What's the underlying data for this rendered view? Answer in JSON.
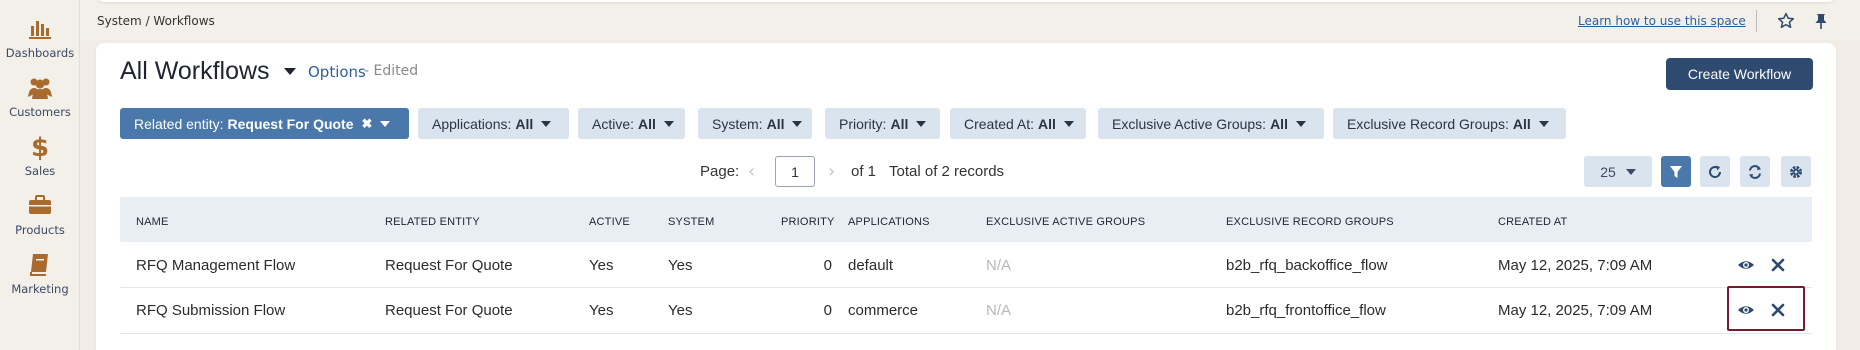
{
  "sidebar": {
    "items": [
      {
        "label": "Dashboards",
        "icon": "bar-chart-icon"
      },
      {
        "label": "Customers",
        "icon": "users-icon"
      },
      {
        "label": "Sales",
        "icon": "dollar-icon"
      },
      {
        "label": "Products",
        "icon": "briefcase-icon"
      },
      {
        "label": "Marketing",
        "icon": "book-icon"
      }
    ]
  },
  "header": {
    "breadcrumb": "System / Workflows",
    "learn_link": "Learn how to use this space"
  },
  "page": {
    "title": "All Workflows",
    "options": "Options",
    "edited": "- Edited",
    "create_button": "Create Workflow"
  },
  "filters": [
    {
      "label": "Related entity:",
      "value": "Request For Quote",
      "active": true
    },
    {
      "label": "Applications:",
      "value": "All"
    },
    {
      "label": "Active:",
      "value": "All"
    },
    {
      "label": "System:",
      "value": "All"
    },
    {
      "label": "Priority:",
      "value": "All"
    },
    {
      "label": "Created At:",
      "value": "All"
    },
    {
      "label": "Exclusive Active Groups:",
      "value": "All"
    },
    {
      "label": "Exclusive Record Groups:",
      "value": "All"
    }
  ],
  "pager": {
    "label": "Page:",
    "current": "1",
    "of": "of 1",
    "total": "Total of 2 records",
    "per_page": "25"
  },
  "table": {
    "columns": [
      "NAME",
      "RELATED ENTITY",
      "ACTIVE",
      "SYSTEM",
      "PRIORITY",
      "APPLICATIONS",
      "EXCLUSIVE ACTIVE GROUPS",
      "EXCLUSIVE RECORD GROUPS",
      "CREATED AT"
    ],
    "rows": [
      {
        "name": "RFQ Management Flow",
        "entity": "Request For Quote",
        "active": "Yes",
        "system": "Yes",
        "priority": "0",
        "applications": "default",
        "active_groups": "N/A",
        "record_groups": "b2b_rfq_backoffice_flow",
        "created": "May 12, 2025, 7:09 AM"
      },
      {
        "name": "RFQ Submission Flow",
        "entity": "Request For Quote",
        "active": "Yes",
        "system": "Yes",
        "priority": "0",
        "applications": "commerce",
        "active_groups": "N/A",
        "record_groups": "b2b_rfq_frontoffice_flow",
        "created": "May 12, 2025, 7:09 AM"
      }
    ]
  },
  "colors": {
    "accent": "#4a78aa",
    "primary_button": "#2e4a6e",
    "highlight": "#7a1a32"
  }
}
